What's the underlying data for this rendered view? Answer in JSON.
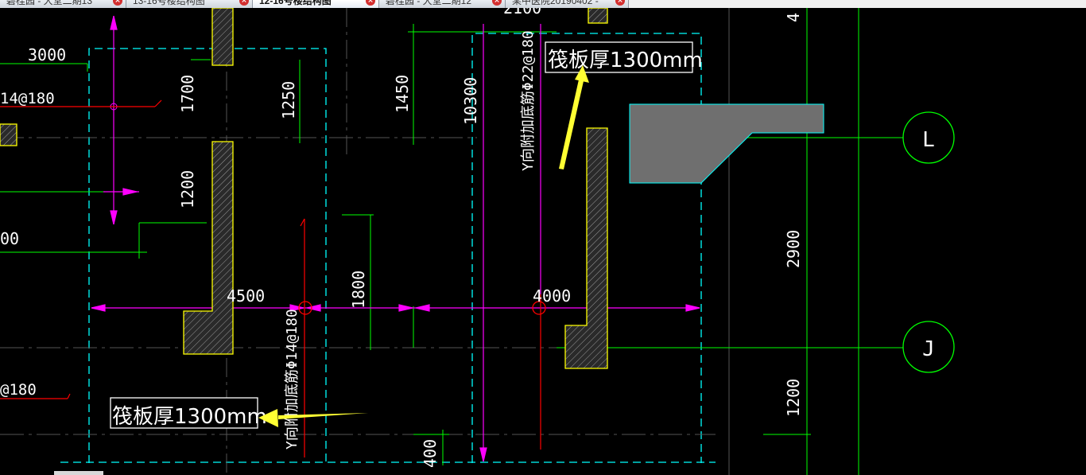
{
  "tabs": [
    {
      "label": "碧桂园 - 大堂二期13",
      "active": false
    },
    {
      "label": "13-16号楼结构图",
      "active": false
    },
    {
      "label": "12-16号楼结构图",
      "active": true
    },
    {
      "label": "碧桂园 - 大堂二期12",
      "active": false
    },
    {
      "label": "某中医院20190402 -",
      "active": false
    }
  ],
  "tab_close_glyph": "×",
  "drawing": {
    "colors": {
      "background": "#000000",
      "dim_green": "#00ff00",
      "axis_magenta": "#ff00ff",
      "boundary_cyan": "#00ffff",
      "wall_yellow": "#ffff00",
      "text_white": "#ffffff",
      "rebar_red": "#ff0000",
      "arrow_yellow": "#ffff33"
    },
    "dimensions": [
      "3000",
      "1700",
      "1250",
      "1450",
      "10300",
      "2100",
      "1200",
      "1800",
      "4500",
      "4000",
      "2900",
      "1200",
      "400",
      "00",
      "4"
    ],
    "rebar_labels": {
      "left_top": "14@180",
      "left_bottom": "@180",
      "vertical_right": "Y向附加底筋Φ22@180",
      "vertical_left": "Y向附加底筋Φ14@180"
    },
    "notes": {
      "raft_top": "筏板厚1300mm",
      "raft_bottom": "筏板厚1300mm"
    },
    "grid_bubbles": {
      "upper": "L",
      "lower": "J"
    }
  }
}
